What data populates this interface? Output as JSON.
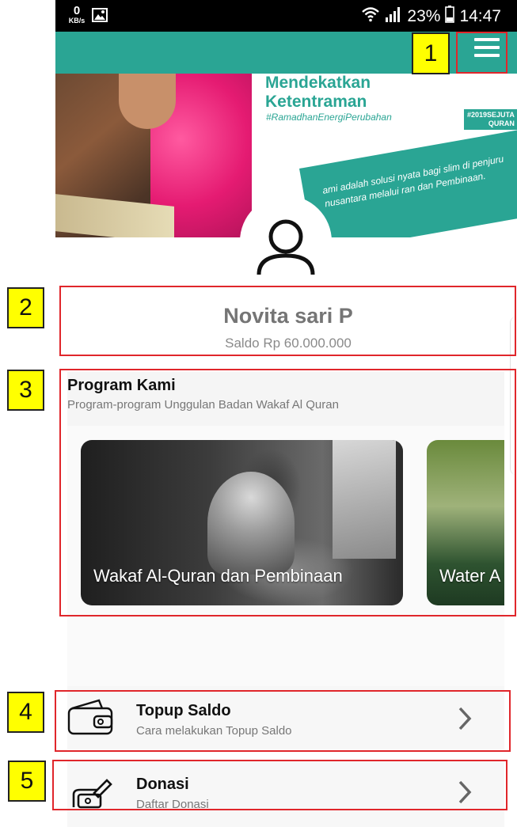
{
  "status_bar": {
    "speed_value": "0",
    "speed_unit": "KB/s",
    "battery": "23%",
    "time": "14:47",
    "icons": [
      "image-icon",
      "wifi-icon",
      "signal-icon",
      "battery-icon"
    ]
  },
  "app_bar": {
    "menu_icon": "hamburger-menu-icon",
    "accent_color": "#2aa594"
  },
  "banner": {
    "title_line1": "Mendekatkan",
    "title_line2": "Ketentraman",
    "hashtag": "#RamadhanEnergiPerubahan",
    "logo_line1": "#2019SEJUTA",
    "logo_line2": "QURAN",
    "stripe_text": "ami adalah solusi nyata bagi slim di penjuru nusantara melalui ran dan Pembinaan."
  },
  "profile": {
    "avatar_icon": "user-avatar-icon",
    "name": "Novita sari P",
    "saldo": "Saldo Rp 60.000.000"
  },
  "programs": {
    "title": "Program Kami",
    "subtitle": "Program-program Unggulan Badan Wakaf Al Quran",
    "cards": [
      {
        "label": "Wakaf Al-Quran dan Pembinaan"
      },
      {
        "label": "Water A"
      }
    ]
  },
  "menu_list": [
    {
      "title": "Topup Saldo",
      "subtitle": "Cara melakukan Topup Saldo",
      "icon": "wallet-icon"
    },
    {
      "title": "Donasi",
      "subtitle": "Daftar Donasi",
      "icon": "donation-hand-icon"
    }
  ],
  "annotations": [
    "1",
    "2",
    "3",
    "4",
    "5"
  ]
}
